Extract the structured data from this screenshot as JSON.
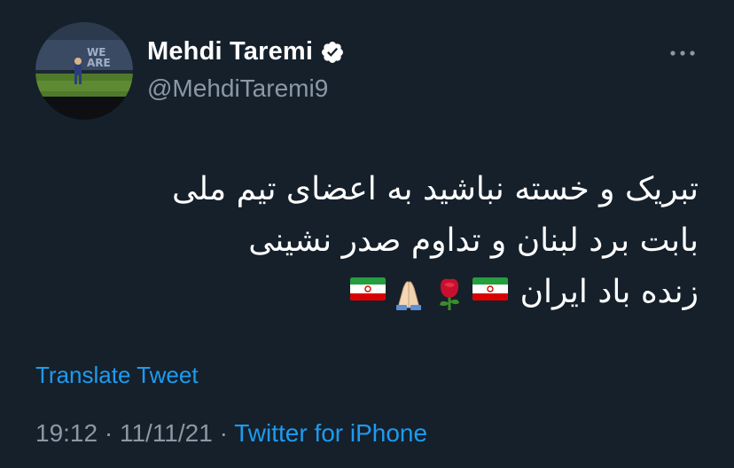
{
  "author": {
    "display_name": "Mehdi Taremi",
    "handle": "@MehdiTaremi9",
    "verified": true,
    "avatar_icon": "player-photo-avatar"
  },
  "tweet": {
    "lines": [
      "تبریک و خسته نباشید به اعضای تیم ملی",
      "بابت برد لبنان و تداوم صدر نشینی",
      "زنده باد ایران"
    ],
    "emojis": [
      "iran-flag",
      "rose",
      "folded-hands",
      "iran-flag"
    ]
  },
  "actions": {
    "translate_label": "Translate Tweet",
    "more_icon": "more-horizontal-icon"
  },
  "meta": {
    "time": "19:12",
    "separator": " · ",
    "date": "11/11/21",
    "source": "Twitter for iPhone"
  },
  "colors": {
    "background": "#15202b",
    "text": "#ffffff",
    "secondary": "#8b98a5",
    "accent": "#1d9bf0"
  }
}
